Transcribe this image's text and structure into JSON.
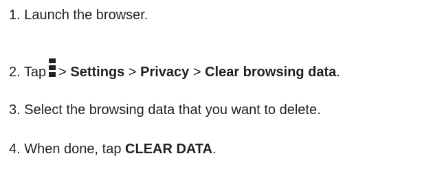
{
  "steps": [
    {
      "number": "1.",
      "text": "Launch the browser."
    },
    {
      "number": "2.",
      "tap": "Tap",
      "icon": "overflow-menu-icon",
      "sep1": ">",
      "settings": "Settings",
      "sep2": ">",
      "privacy": "Privacy",
      "sep3": ">",
      "clear_browsing_data": "Clear browsing data",
      "end": "."
    },
    {
      "number": "3.",
      "text": "Select the browsing data that you want to delete."
    },
    {
      "number": "4.",
      "prefix": "When done, tap",
      "clear_data": "CLEAR DATA",
      "end": "."
    }
  ]
}
